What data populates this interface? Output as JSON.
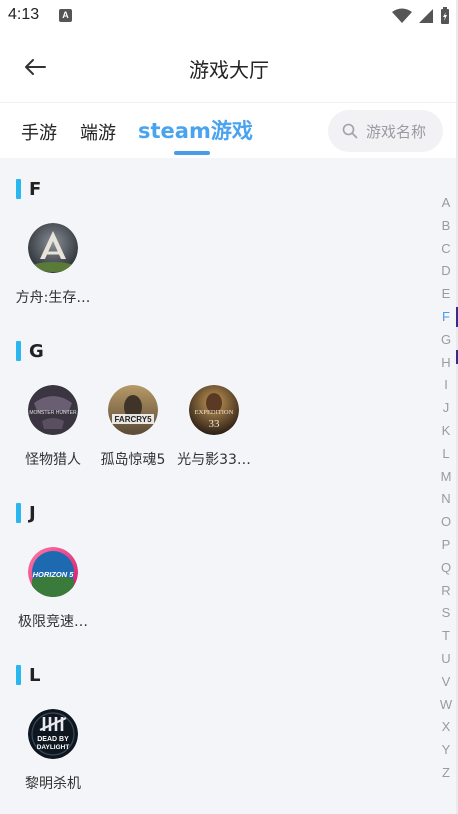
{
  "status_bar": {
    "time": "4:13",
    "notification_letter": "A"
  },
  "header": {
    "title": "游戏大厅"
  },
  "tabs": [
    {
      "label": "手游"
    },
    {
      "label": "端游"
    },
    {
      "label": "steam游戏"
    }
  ],
  "active_tab": "steam游戏",
  "search": {
    "placeholder": "游戏名称"
  },
  "sections": [
    {
      "letter": "F",
      "games": [
        {
          "name": "方舟:生存…"
        }
      ]
    },
    {
      "letter": "G",
      "games": [
        {
          "name": "怪物猎人"
        },
        {
          "name": "孤岛惊魂5"
        },
        {
          "name": "光与影33…"
        }
      ]
    },
    {
      "letter": "J",
      "games": [
        {
          "name": "极限竞速…"
        }
      ]
    },
    {
      "letter": "L",
      "games": [
        {
          "name": "黎明杀机"
        }
      ]
    }
  ],
  "icon_texts": {
    "monster_hunter": "MONSTER HUNTER",
    "farcry": "FARCRY5",
    "expedition": "EXPEDITION",
    "expedition_num": "33",
    "horizon": "HORIZON 5",
    "dbd_line1": "DEAD BY",
    "dbd_line2": "DAYLIGHT"
  },
  "alphabet": [
    "A",
    "B",
    "C",
    "D",
    "E",
    "F",
    "G",
    "H",
    "I",
    "J",
    "K",
    "L",
    "M",
    "N",
    "O",
    "P",
    "Q",
    "R",
    "S",
    "T",
    "U",
    "V",
    "W",
    "X",
    "Y",
    "Z"
  ],
  "active_letter": "F",
  "colors": {
    "accent": "#4aa3ee",
    "section_bar": "#2ab6ef",
    "background": "#f4f5f9"
  }
}
